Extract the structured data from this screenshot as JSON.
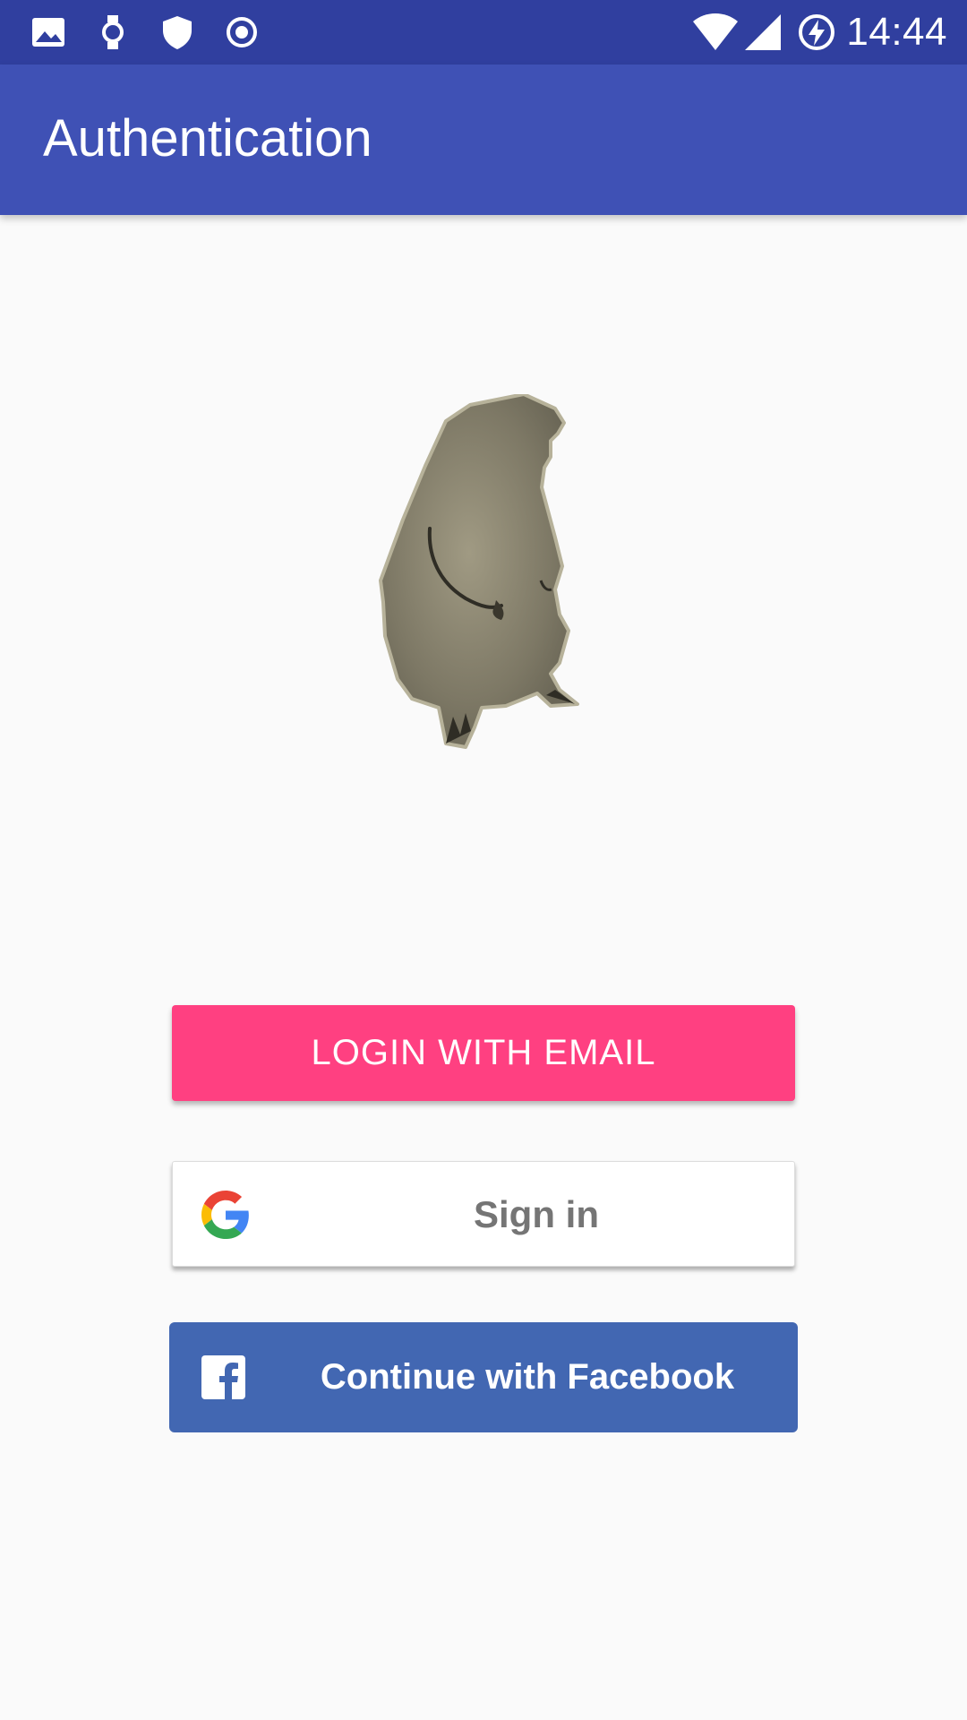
{
  "status_bar": {
    "time": "14:44",
    "background": "#303f9f",
    "left_icons": [
      "image-icon",
      "watch-icon",
      "shield-icon",
      "record-icon"
    ],
    "right_icons": [
      "wifi-icon",
      "cell-signal-icon",
      "battery-charging-icon"
    ]
  },
  "app_bar": {
    "title": "Authentication",
    "background": "#3f51b5"
  },
  "logo": {
    "icon": "groundhog-logo"
  },
  "buttons": {
    "email": {
      "label": "LOGIN WITH EMAIL",
      "color": "#ff4081"
    },
    "google": {
      "label": "Sign in",
      "icon": "google-g-icon"
    },
    "facebook": {
      "label": "Continue with Facebook",
      "icon": "facebook-f-icon",
      "color": "#4267b2"
    }
  }
}
